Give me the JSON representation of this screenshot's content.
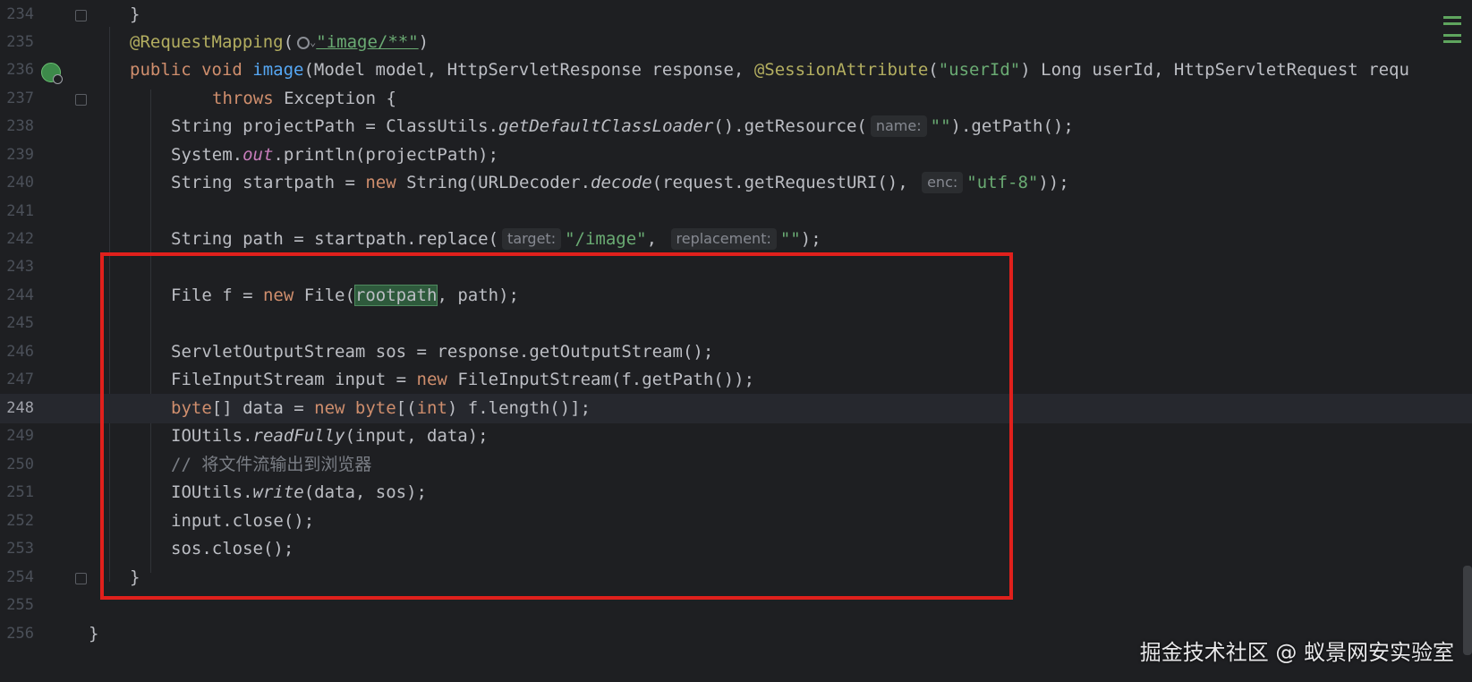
{
  "editor": {
    "lines": [
      {
        "num": "234"
      },
      {
        "num": "235"
      },
      {
        "num": "236"
      },
      {
        "num": "237"
      },
      {
        "num": "238"
      },
      {
        "num": "239"
      },
      {
        "num": "240"
      },
      {
        "num": "241"
      },
      {
        "num": "242"
      },
      {
        "num": "243"
      },
      {
        "num": "244"
      },
      {
        "num": "245"
      },
      {
        "num": "246"
      },
      {
        "num": "247"
      },
      {
        "num": "248"
      },
      {
        "num": "249"
      },
      {
        "num": "250"
      },
      {
        "num": "251"
      },
      {
        "num": "252"
      },
      {
        "num": "253"
      },
      {
        "num": "254"
      },
      {
        "num": "255"
      },
      {
        "num": "256"
      }
    ],
    "current_line": "248",
    "hints": {
      "name": "name:",
      "enc": "enc:",
      "target": "target:",
      "replacement": "replacement:"
    },
    "comment": "// 将文件流输出到浏览器"
  },
  "watermark": "掘金技术社区 @ 蚁景网安实验室",
  "colors": {
    "background": "#1e1f22",
    "keyword": "#cf8e6d",
    "string": "#6aab73",
    "annotation": "#b3ae60",
    "method": "#56a8f5",
    "highlight_box": "#e0201c"
  }
}
